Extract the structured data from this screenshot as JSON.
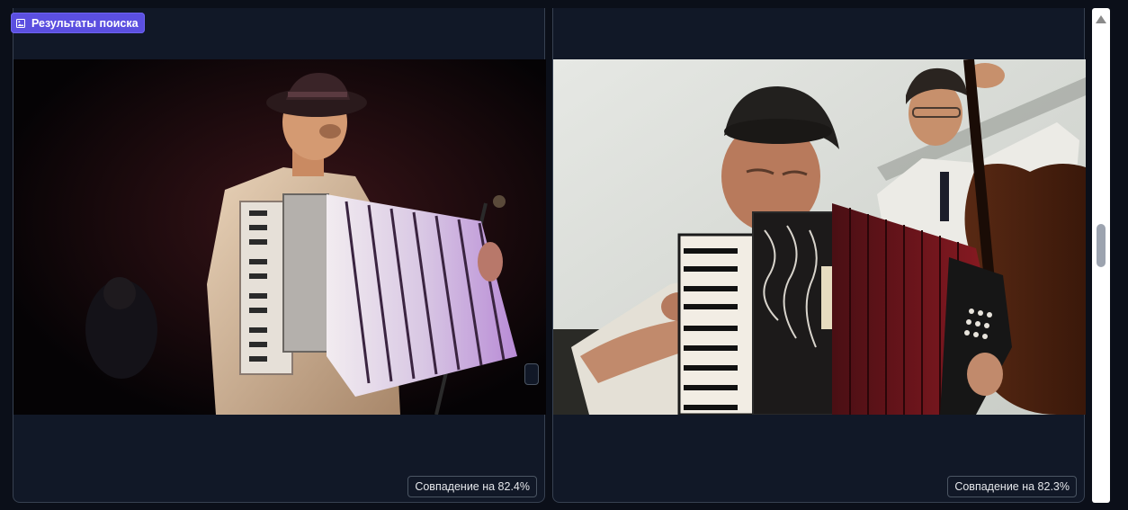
{
  "search_results": {
    "badge_label": "Результаты поиска",
    "badge_icon": "image-icon",
    "accent_color": "#5b4fe0"
  },
  "results": [
    {
      "match_label": "Совпадение на 82.4%",
      "match_percent": 82.4
    },
    {
      "match_label": "Совпадение на 82.3%",
      "match_percent": 82.3
    }
  ],
  "scrollbar": {
    "up_icon": "arrow-up-icon"
  }
}
